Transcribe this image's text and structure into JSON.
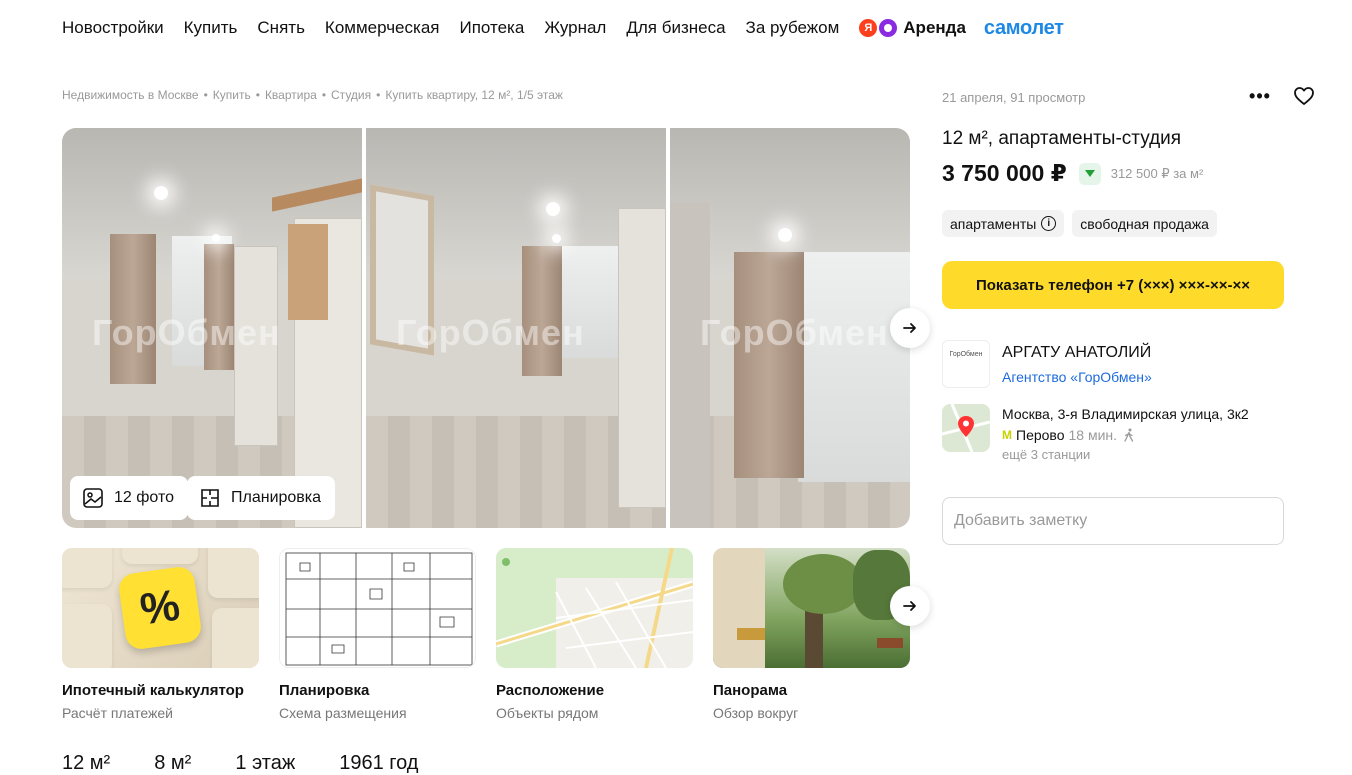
{
  "nav": {
    "items": [
      "Новостройки",
      "Купить",
      "Снять",
      "Коммерческая",
      "Ипотека",
      "Журнал",
      "Для бизнеса",
      "За рубежом"
    ],
    "arenda_logo_text": "Я",
    "arenda_label": "Аренда",
    "samolet_label": "самолет"
  },
  "breadcrumbs": [
    "Недвижимость в Москве",
    "Купить",
    "Квартира",
    "Студия",
    "Купить квартиру, 12 м², 1/5 этаж"
  ],
  "breadcrumb_sep": "•",
  "gallery": {
    "watermark": "ГорОбмен",
    "photos_button": "12 фото",
    "plan_button": "Планировка"
  },
  "cards": [
    {
      "title": "Ипотечный калькулятор",
      "subtitle": "Расчёт платежей",
      "icon_text": "%"
    },
    {
      "title": "Планировка",
      "subtitle": "Схема размещения"
    },
    {
      "title": "Расположение",
      "subtitle": "Объекты рядом"
    },
    {
      "title": "Панорама",
      "subtitle": "Обзор вокруг"
    }
  ],
  "stats": [
    "12 м²",
    "8 м²",
    "1 этаж",
    "1961 год"
  ],
  "offer": {
    "meta": "21 апреля, 91 просмотр",
    "title": "12 м², апартаменты-студия",
    "price": "3 750 000 ₽",
    "price_per_m2": "312 500 ₽ за м²",
    "tags": [
      "апартаменты",
      "свободная продажа"
    ],
    "phone_button": "Показать телефон +7 (×××) ×××-××-××",
    "agent_name": "АРГАТУ АНАТОЛИЙ",
    "agency": "Агентство «ГорОбмен»",
    "agency_logo_text": "ГорОбмен",
    "address": "Москва, 3-я Владимирская улица, 3к2",
    "metro_logo": "M",
    "metro_station": "Перово",
    "metro_time": "18 мин.",
    "more_stations": "ещё 3 станции",
    "note_placeholder": "Добавить заметку"
  },
  "colors": {
    "accent_yellow": "#fedb2a",
    "link_blue": "#1e6bdc",
    "samolet_blue": "#1e88e5",
    "price_down_green": "#21a038"
  }
}
